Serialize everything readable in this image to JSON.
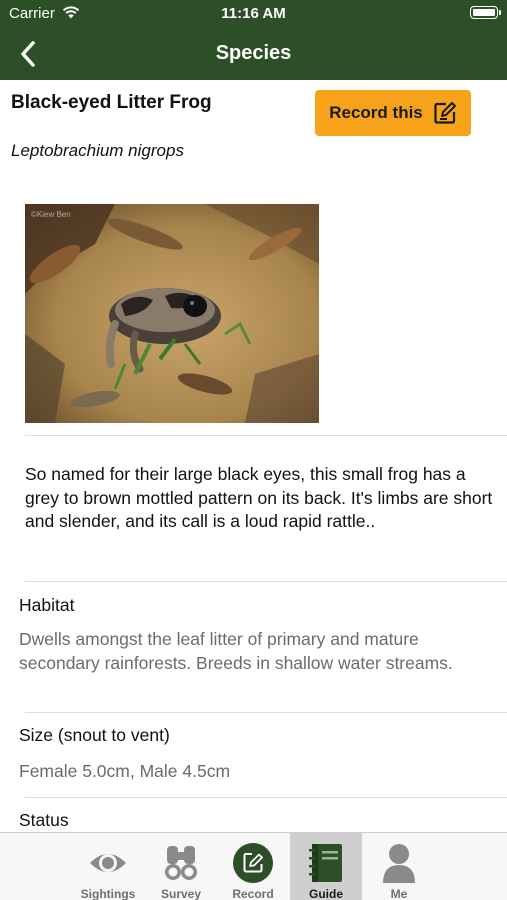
{
  "status_bar": {
    "carrier": "Carrier",
    "time": "11:16 AM"
  },
  "nav": {
    "title": "Species"
  },
  "species": {
    "common_name": "Black-eyed Litter Frog",
    "scientific_name": "Leptobrachium nigrops",
    "record_button_label": "Record this",
    "photo_watermark": "©Kiew Ben",
    "description": "So named for their large black eyes, this small frog has a grey to brown mottled pattern on its back. It's limbs are short and slender, and its call is a loud rapid rattle..",
    "habitat_label": "Habitat",
    "habitat_value": "Dwells amongst the leaf litter of primary and mature secondary rainforests. Breeds in shallow water streams.",
    "size_label": "Size (snout to vent)",
    "size_value": "Female 5.0cm, Male 4.5cm",
    "status_label": "Status"
  },
  "tabs": [
    {
      "label": "Sightings",
      "icon": "eye-icon",
      "active": false
    },
    {
      "label": "Survey",
      "icon": "binoculars-icon",
      "active": false
    },
    {
      "label": "Record",
      "icon": "record-icon",
      "active": false
    },
    {
      "label": "Guide",
      "icon": "book-icon",
      "active": true
    },
    {
      "label": "Me",
      "icon": "person-icon",
      "active": false
    }
  ],
  "colors": {
    "header": "#2d4f27",
    "accent_orange": "#f7a21b",
    "tab_active_bg": "#cfcfcf",
    "muted_text": "#6b6b6b"
  }
}
